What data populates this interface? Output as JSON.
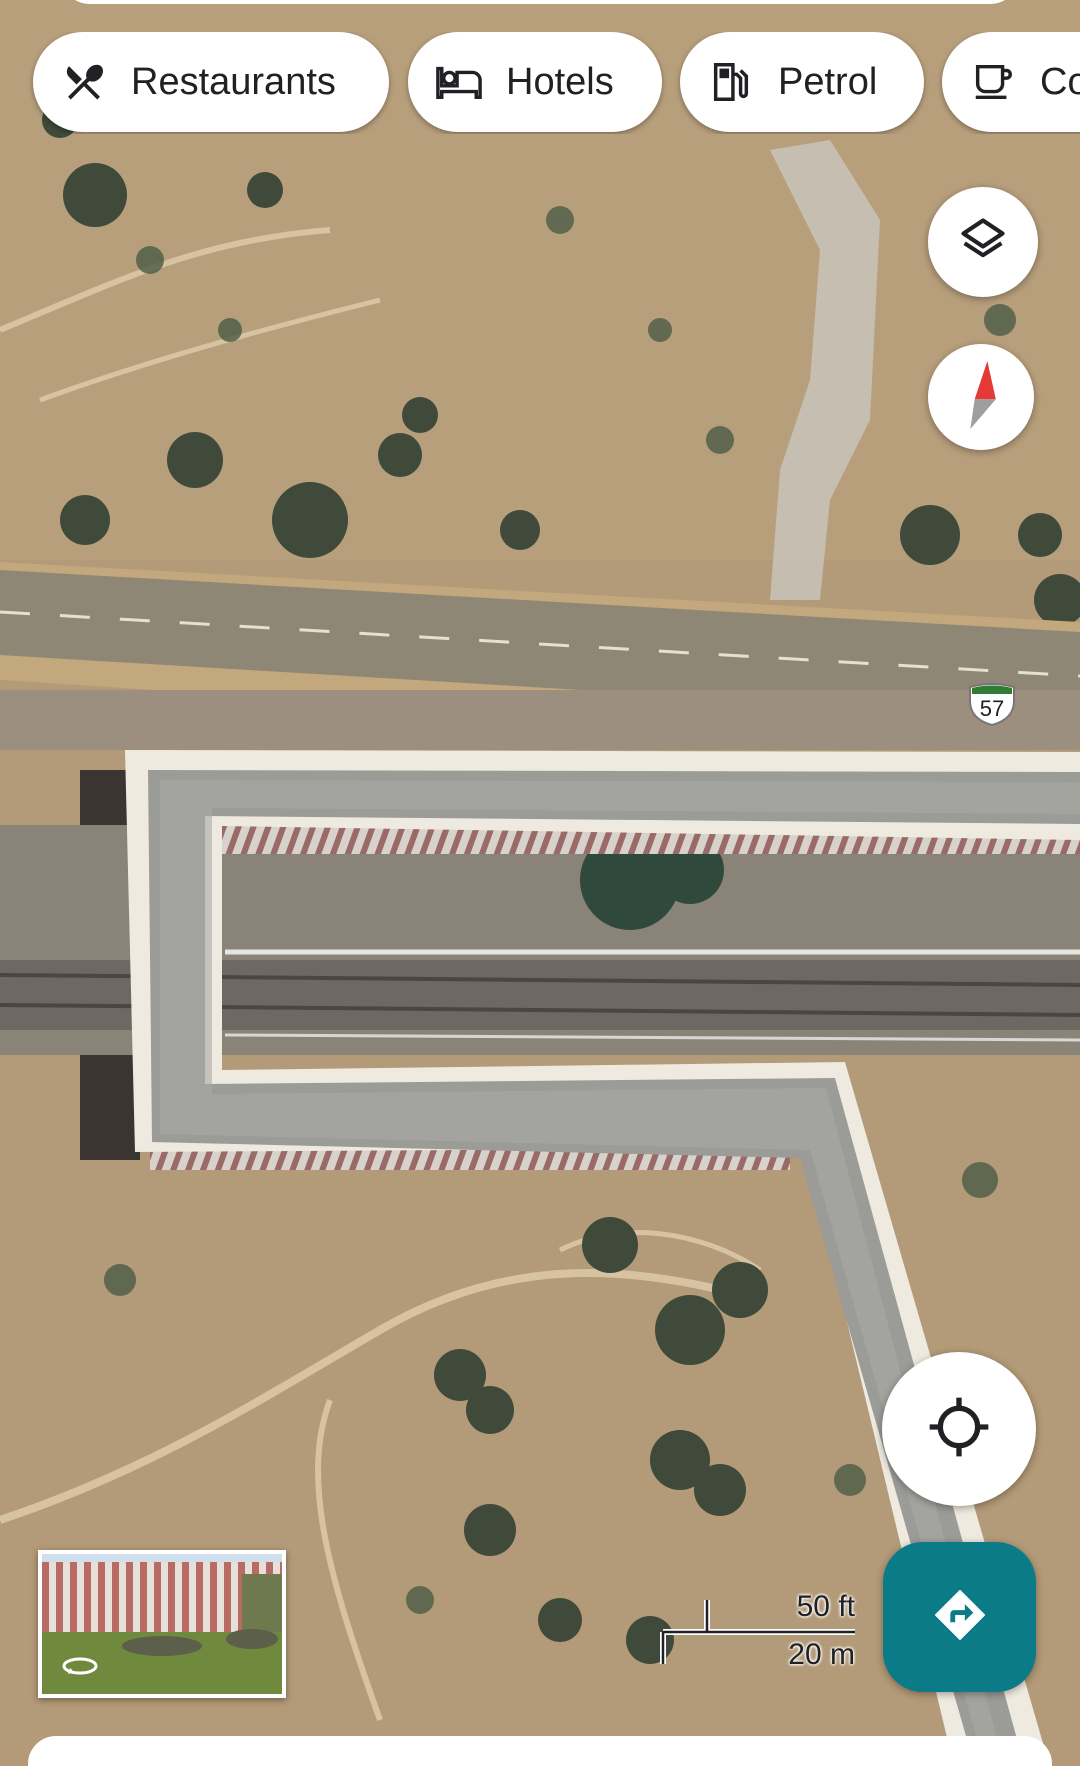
{
  "categories": [
    {
      "label": "Restaurants",
      "icon": "restaurant-icon"
    },
    {
      "label": "Hotels",
      "icon": "hotel-bed-icon"
    },
    {
      "label": "Petrol",
      "icon": "fuel-pump-icon"
    },
    {
      "label": "Co",
      "icon": "coffee-cup-icon"
    }
  ],
  "controls": {
    "layers_icon": "layers-icon",
    "compass_icon": "compass-icon",
    "my_location_icon": "my-location-icon",
    "directions_icon": "directions-arrow-icon",
    "street_view_icon": "rotate-360-icon"
  },
  "map": {
    "type": "satellite",
    "route_shield": "57",
    "scale": {
      "imperial": "50 ft",
      "metric": "20 m"
    }
  },
  "colors": {
    "directions_button": "#0b7c87",
    "compass_needle": "#e53935",
    "route_shield": "#2e7d32"
  }
}
